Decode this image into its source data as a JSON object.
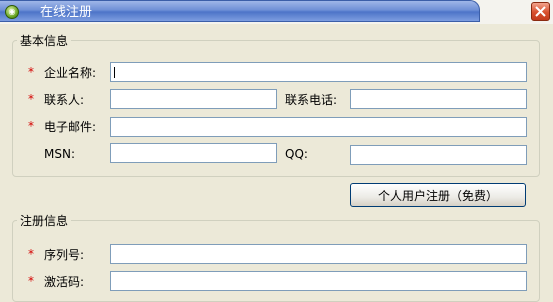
{
  "window": {
    "title": "在线注册"
  },
  "basic_info": {
    "legend": "基本信息",
    "required_mark": "*",
    "company_name": {
      "label": "企业名称:",
      "value": ""
    },
    "contact": {
      "label": "联系人:",
      "value": ""
    },
    "contact_phone": {
      "label": "联系电话:",
      "value": ""
    },
    "email": {
      "label": "电子邮件:",
      "value": ""
    },
    "msn": {
      "label": "MSN:",
      "value": ""
    },
    "qq": {
      "label": "QQ:",
      "value": ""
    }
  },
  "personal_button": {
    "label": "个人用户注册（免费）"
  },
  "registration_info": {
    "legend": "注册信息",
    "required_mark": "*",
    "serial": {
      "label": "序列号:",
      "value": ""
    },
    "activation": {
      "label": "激活码:",
      "value": ""
    }
  },
  "colors": {
    "title_bar": "#6f90d6",
    "required": "#d40000",
    "background": "#ece9d8"
  }
}
